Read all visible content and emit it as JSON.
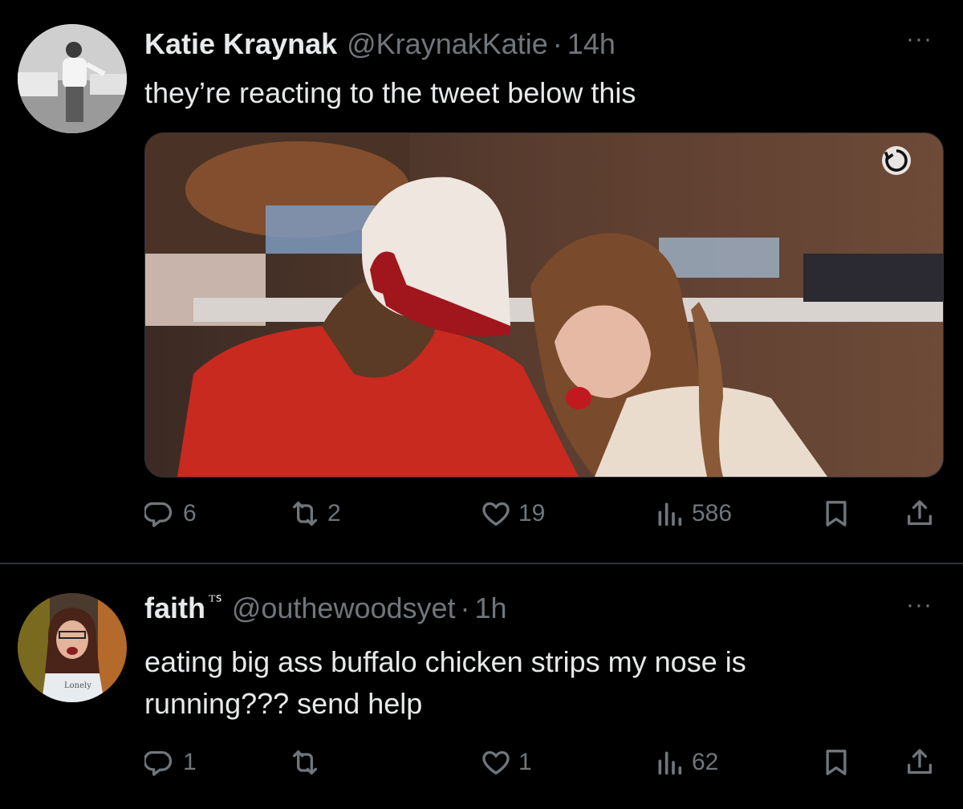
{
  "tweets": [
    {
      "name": "Katie Kraynak",
      "badge": "",
      "handle": "@KraynakKatie",
      "dot": "·",
      "time": "14h",
      "more": "···",
      "text_lines": [
        "they’re reacting to the tweet below this"
      ],
      "has_media": true,
      "actions": {
        "replies": "6",
        "retweets": "2",
        "likes": "19",
        "views": "586"
      }
    },
    {
      "name": "faith",
      "badge": "ᵀᔆ",
      "handle": "@outhewoodsyet",
      "dot": "·",
      "time": "1h",
      "more": "···",
      "text_lines": [
        "eating big ass buffalo chicken strips my nose is",
        "running??? send help"
      ],
      "has_media": false,
      "actions": {
        "replies": "1",
        "retweets": "",
        "likes": "1",
        "views": "62"
      }
    }
  ],
  "icons": {
    "reply": "reply-icon",
    "retweet": "retweet-icon",
    "like": "heart-icon",
    "views": "views-icon",
    "bookmark": "bookmark-icon",
    "share": "share-icon",
    "more": "more-icon",
    "gif": "gif-autoplay-icon"
  },
  "colors": {
    "background": "#000000",
    "text": "#e7e9ea",
    "secondary": "#71767b",
    "divider": "#2f3336"
  }
}
